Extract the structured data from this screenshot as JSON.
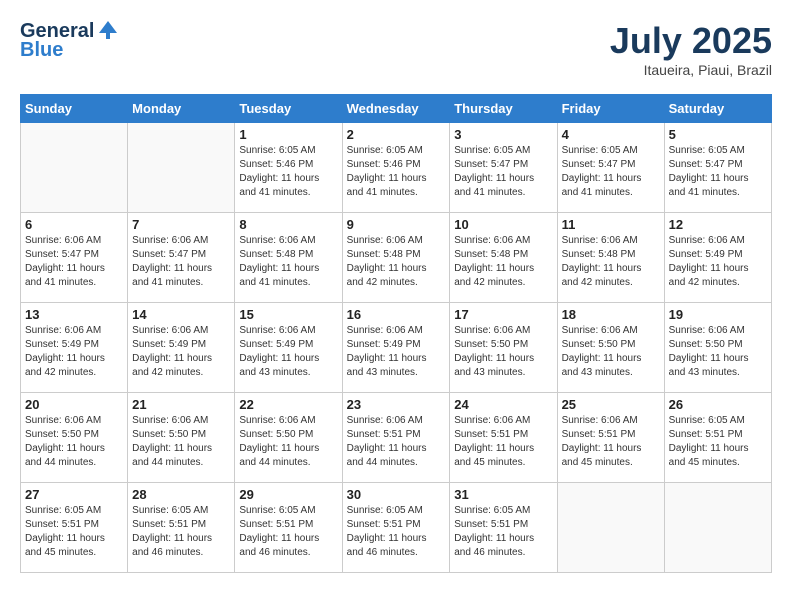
{
  "header": {
    "logo_general": "General",
    "logo_blue": "Blue",
    "month": "July 2025",
    "location": "Itaueira, Piaui, Brazil"
  },
  "weekdays": [
    "Sunday",
    "Monday",
    "Tuesday",
    "Wednesday",
    "Thursday",
    "Friday",
    "Saturday"
  ],
  "weeks": [
    [
      {
        "day": "",
        "info": ""
      },
      {
        "day": "",
        "info": ""
      },
      {
        "day": "1",
        "info": "Sunrise: 6:05 AM\nSunset: 5:46 PM\nDaylight: 11 hours and 41 minutes."
      },
      {
        "day": "2",
        "info": "Sunrise: 6:05 AM\nSunset: 5:46 PM\nDaylight: 11 hours and 41 minutes."
      },
      {
        "day": "3",
        "info": "Sunrise: 6:05 AM\nSunset: 5:47 PM\nDaylight: 11 hours and 41 minutes."
      },
      {
        "day": "4",
        "info": "Sunrise: 6:05 AM\nSunset: 5:47 PM\nDaylight: 11 hours and 41 minutes."
      },
      {
        "day": "5",
        "info": "Sunrise: 6:05 AM\nSunset: 5:47 PM\nDaylight: 11 hours and 41 minutes."
      }
    ],
    [
      {
        "day": "6",
        "info": "Sunrise: 6:06 AM\nSunset: 5:47 PM\nDaylight: 11 hours and 41 minutes."
      },
      {
        "day": "7",
        "info": "Sunrise: 6:06 AM\nSunset: 5:47 PM\nDaylight: 11 hours and 41 minutes."
      },
      {
        "day": "8",
        "info": "Sunrise: 6:06 AM\nSunset: 5:48 PM\nDaylight: 11 hours and 41 minutes."
      },
      {
        "day": "9",
        "info": "Sunrise: 6:06 AM\nSunset: 5:48 PM\nDaylight: 11 hours and 42 minutes."
      },
      {
        "day": "10",
        "info": "Sunrise: 6:06 AM\nSunset: 5:48 PM\nDaylight: 11 hours and 42 minutes."
      },
      {
        "day": "11",
        "info": "Sunrise: 6:06 AM\nSunset: 5:48 PM\nDaylight: 11 hours and 42 minutes."
      },
      {
        "day": "12",
        "info": "Sunrise: 6:06 AM\nSunset: 5:49 PM\nDaylight: 11 hours and 42 minutes."
      }
    ],
    [
      {
        "day": "13",
        "info": "Sunrise: 6:06 AM\nSunset: 5:49 PM\nDaylight: 11 hours and 42 minutes."
      },
      {
        "day": "14",
        "info": "Sunrise: 6:06 AM\nSunset: 5:49 PM\nDaylight: 11 hours and 42 minutes."
      },
      {
        "day": "15",
        "info": "Sunrise: 6:06 AM\nSunset: 5:49 PM\nDaylight: 11 hours and 43 minutes."
      },
      {
        "day": "16",
        "info": "Sunrise: 6:06 AM\nSunset: 5:49 PM\nDaylight: 11 hours and 43 minutes."
      },
      {
        "day": "17",
        "info": "Sunrise: 6:06 AM\nSunset: 5:50 PM\nDaylight: 11 hours and 43 minutes."
      },
      {
        "day": "18",
        "info": "Sunrise: 6:06 AM\nSunset: 5:50 PM\nDaylight: 11 hours and 43 minutes."
      },
      {
        "day": "19",
        "info": "Sunrise: 6:06 AM\nSunset: 5:50 PM\nDaylight: 11 hours and 43 minutes."
      }
    ],
    [
      {
        "day": "20",
        "info": "Sunrise: 6:06 AM\nSunset: 5:50 PM\nDaylight: 11 hours and 44 minutes."
      },
      {
        "day": "21",
        "info": "Sunrise: 6:06 AM\nSunset: 5:50 PM\nDaylight: 11 hours and 44 minutes."
      },
      {
        "day": "22",
        "info": "Sunrise: 6:06 AM\nSunset: 5:50 PM\nDaylight: 11 hours and 44 minutes."
      },
      {
        "day": "23",
        "info": "Sunrise: 6:06 AM\nSunset: 5:51 PM\nDaylight: 11 hours and 44 minutes."
      },
      {
        "day": "24",
        "info": "Sunrise: 6:06 AM\nSunset: 5:51 PM\nDaylight: 11 hours and 45 minutes."
      },
      {
        "day": "25",
        "info": "Sunrise: 6:06 AM\nSunset: 5:51 PM\nDaylight: 11 hours and 45 minutes."
      },
      {
        "day": "26",
        "info": "Sunrise: 6:05 AM\nSunset: 5:51 PM\nDaylight: 11 hours and 45 minutes."
      }
    ],
    [
      {
        "day": "27",
        "info": "Sunrise: 6:05 AM\nSunset: 5:51 PM\nDaylight: 11 hours and 45 minutes."
      },
      {
        "day": "28",
        "info": "Sunrise: 6:05 AM\nSunset: 5:51 PM\nDaylight: 11 hours and 46 minutes."
      },
      {
        "day": "29",
        "info": "Sunrise: 6:05 AM\nSunset: 5:51 PM\nDaylight: 11 hours and 46 minutes."
      },
      {
        "day": "30",
        "info": "Sunrise: 6:05 AM\nSunset: 5:51 PM\nDaylight: 11 hours and 46 minutes."
      },
      {
        "day": "31",
        "info": "Sunrise: 6:05 AM\nSunset: 5:51 PM\nDaylight: 11 hours and 46 minutes."
      },
      {
        "day": "",
        "info": ""
      },
      {
        "day": "",
        "info": ""
      }
    ]
  ]
}
